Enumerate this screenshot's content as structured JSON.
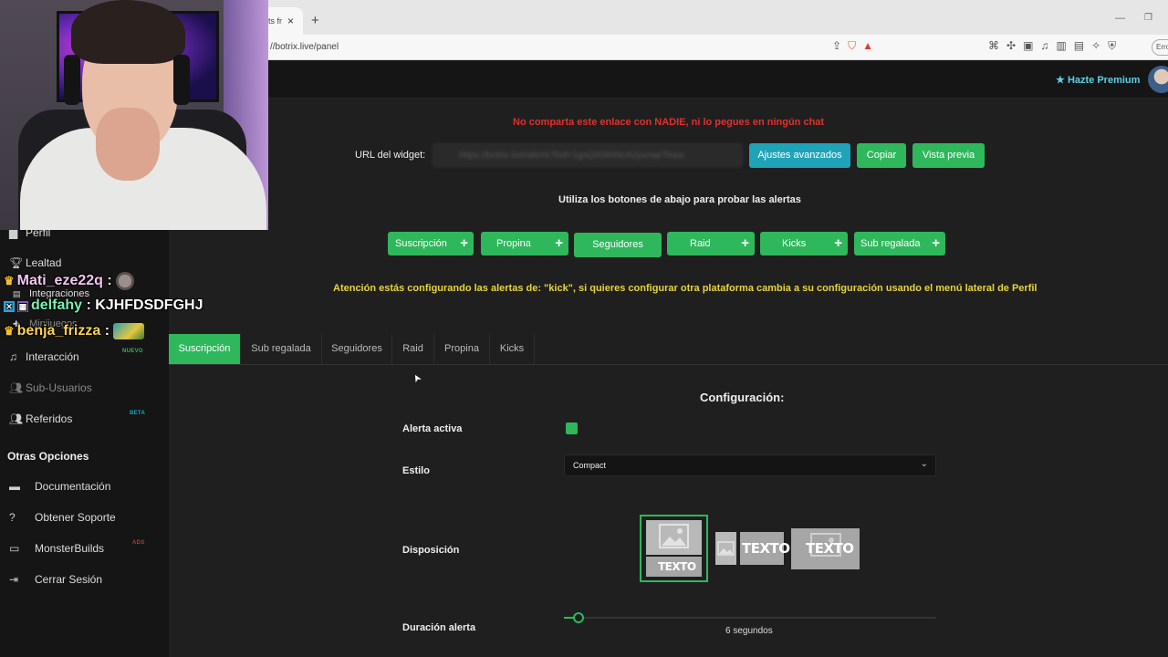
{
  "browser": {
    "tab_title": "ts fr",
    "tab_close": "×",
    "new_tab": "+",
    "url": "//botrix.live/panel",
    "error_chip": "Erro",
    "win_min": "—",
    "win_max": "❐"
  },
  "header": {
    "premium_label": "Hazte Premium"
  },
  "sidebar": {
    "items": [
      {
        "label": "Perfil",
        "icon": "user-icon"
      },
      {
        "label": "Lealtad",
        "icon": "trophy-icon"
      },
      {
        "label": "Integraciones",
        "icon": "plug-icon"
      },
      {
        "label": "Minijuegos",
        "icon": "gamepad-icon"
      },
      {
        "label": "Interacción",
        "icon": "music-icon",
        "badge": "NUEVO"
      },
      {
        "label": "Sub-Usuarios",
        "icon": "users-icon"
      },
      {
        "label": "Referidos",
        "icon": "users-icon",
        "badge": "BETA"
      }
    ],
    "section_title": "Otras Opciones",
    "other_items": [
      {
        "label": "Documentación",
        "icon": "doc-icon"
      },
      {
        "label": "Obtener Soporte",
        "icon": "help-icon"
      },
      {
        "label": "MonsterBuilds",
        "icon": "laptop-icon",
        "badge": "ADS"
      },
      {
        "label": "Cerrar Sesión",
        "icon": "logout-icon"
      }
    ],
    "badge_colors": {
      "NUEVO": "#2fb75c",
      "BETA": "#1ea3b8",
      "ADS": "#c0392b"
    }
  },
  "chat": [
    {
      "user": "Mati_eze22q",
      "sep": " :",
      "message": ""
    },
    {
      "user": "delfahy",
      "sep": " : ",
      "message": "KJHFDSDFGHJ"
    },
    {
      "user": "benja_frizza",
      "sep": " :",
      "message": ""
    }
  ],
  "panel": {
    "warning_red": "No comparta este enlace con NADIE, ni lo pegues en ningún chat",
    "url_label": "URL del widget:",
    "url_value": "https://botrix.live/alerts?bid=1gsQ9SkhNcA2pxnqeTkaw",
    "btn_advanced": "Ajustes avanzados",
    "btn_copy": "Copiar",
    "btn_preview": "Vista previa",
    "hint": "Utiliza los botones de abajo para probar las alertas",
    "test_buttons": [
      "Suscripción",
      "Propina",
      "Seguidores",
      "Raid",
      "Kicks",
      "Sub regalada"
    ],
    "attention": "Atención estás configurando las alertas de: \"kick\", si quieres configurar otra plataforma cambia a su configuración usando el menú lateral de Perfil",
    "tabs": [
      "Suscripción",
      "Sub regalada",
      "Seguidores",
      "Raid",
      "Propina",
      "Kicks"
    ],
    "active_tab": "Suscripción"
  },
  "config": {
    "title": "Configuración:",
    "active_label": "Alerta activa",
    "active_value": true,
    "style_label": "Estilo",
    "style_value": "Compact",
    "layout_label": "Disposición",
    "layout_text": "TEXTO",
    "duration_label": "Duración alerta",
    "duration_value": "6 segundos",
    "duration_fraction": 0.04
  },
  "colors": {
    "accent": "#2fb75c",
    "info": "#1ea3b8",
    "danger": "#e0312c",
    "warning": "#e8d43a",
    "premium": "#5ad1e6"
  }
}
